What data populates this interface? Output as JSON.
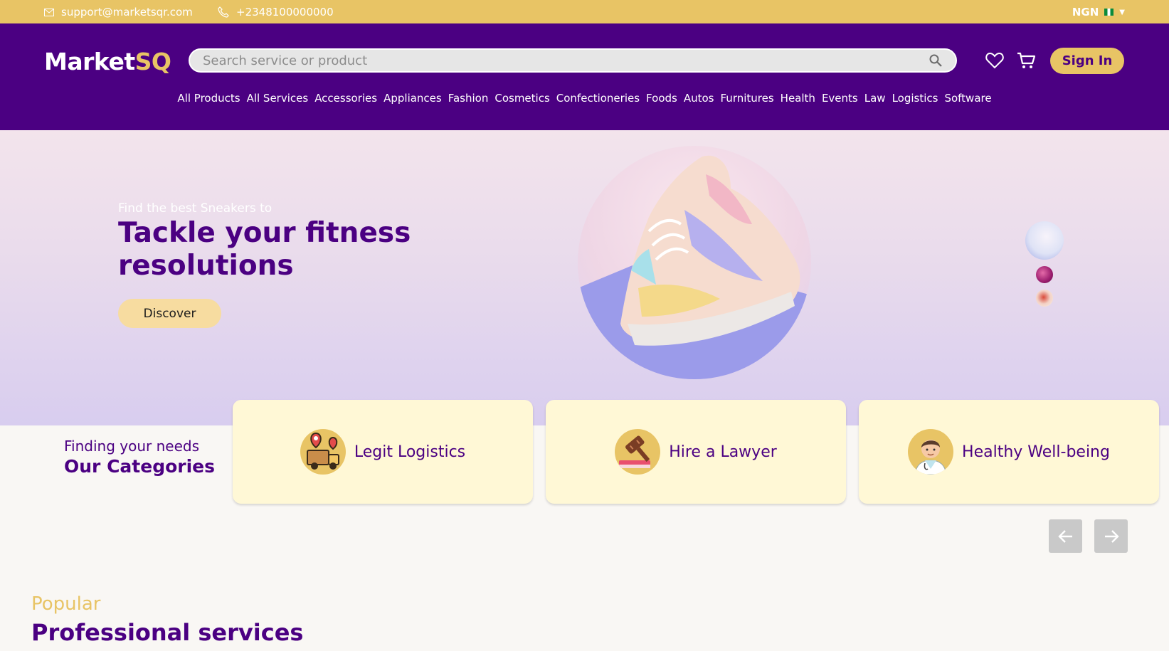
{
  "topbar": {
    "email": "support@marketsqr.com",
    "phone": "+2348100000000",
    "currency": "NGN"
  },
  "header": {
    "logo_main": "Market",
    "logo_accent": "SQ",
    "search_placeholder": "Search service or product",
    "sign_in": "Sign In"
  },
  "nav": [
    "All Products",
    "All Services",
    "Accessories",
    "Appliances",
    "Fashion",
    "Cosmetics",
    "Confectioneries",
    "Foods",
    "Autos",
    "Furnitures",
    "Health",
    "Events",
    "Law",
    "Logistics",
    "Software"
  ],
  "hero": {
    "tagline": "Find the best Sneakers to",
    "headline": "Tackle your fitness resolutions",
    "cta": "Discover"
  },
  "categories": {
    "subtitle": "Finding your needs",
    "title": "Our Categories",
    "cards": [
      {
        "label": "Legit Logistics",
        "icon": "logistics-icon"
      },
      {
        "label": "Hire a Lawyer",
        "icon": "gavel-icon"
      },
      {
        "label": "Healthy Well-being",
        "icon": "doctor-icon"
      }
    ]
  },
  "popular": {
    "subtitle": "Popular",
    "title": "Professional services"
  },
  "colors": {
    "primary": "#4b0082",
    "accent": "#e8c465",
    "card_bg": "#fff8d6"
  }
}
